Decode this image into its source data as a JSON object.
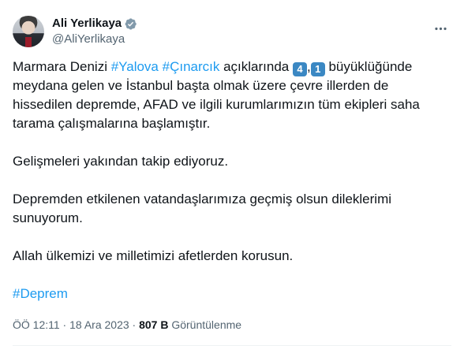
{
  "author": {
    "display_name": "Ali Yerlikaya",
    "handle": "@AliYerlikaya",
    "verified_icon": "verified-badge-icon",
    "avatar": "avatar"
  },
  "tweet": {
    "p1": {
      "t1": "Marmara Denizi ",
      "tag1": "#Yalova",
      "space": " ",
      "tag2": "#Çınarcık",
      "t2": " açıklarında ",
      "key1": "4",
      "comma": ",",
      "key2": "1",
      "t3": " büyüklüğünde meydana gelen ve İstanbul başta olmak üzere çevre illerden de hissedilen depremde, AFAD ve ilgili kurumlarımızın tüm ekipleri saha tarama çalışmalarına başlamıştır."
    },
    "p2": "Gelişmeleri yakından takip ediyoruz.",
    "p3": "Depremden etkilenen vatandaşlarımıza geçmiş olsun dileklerimi sunuyorum.",
    "p4": "Allah ülkemizi ve milletimizi afetlerden korusun.",
    "p5_tag": "#Deprem"
  },
  "meta": {
    "time": "ÖÖ 12:11",
    "sep1": " · ",
    "date": "18 Ara 2023",
    "sep2": " · ",
    "views": "807 B",
    "views_label": " Görüntülenme"
  },
  "colors": {
    "link": "#1d9bf0",
    "secondary_text": "#536471",
    "keycap": "#3b88c3"
  }
}
